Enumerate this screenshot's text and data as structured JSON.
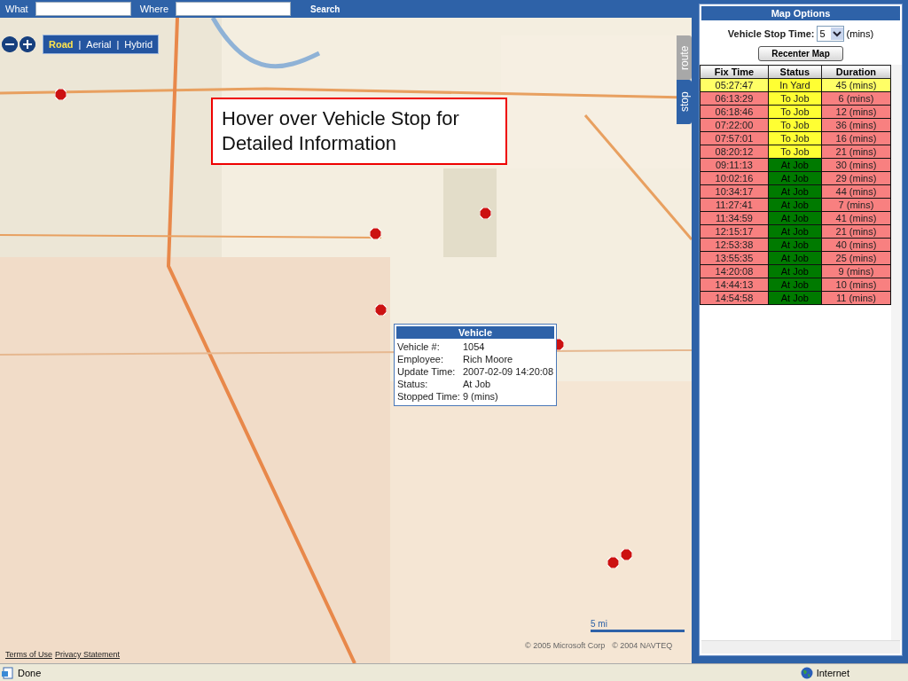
{
  "search_bar": {
    "what_label": "What",
    "where_label": "Where",
    "search_button": "Search"
  },
  "map": {
    "style_switch": [
      {
        "label": "Road",
        "selected": true
      },
      {
        "label": "Aerial",
        "selected": false
      },
      {
        "label": "Hybrid",
        "selected": false
      }
    ],
    "style_separator": "|",
    "callout": "Hover over Vehicle Stop for Detailed Information",
    "popup": {
      "title": "Vehicle",
      "fields": [
        {
          "label": "Vehicle #:",
          "value": "1054"
        },
        {
          "label": "Employee:",
          "value": "Rich Moore"
        },
        {
          "label": "Update Time:",
          "value": "2007-02-09 14:20:08"
        },
        {
          "label": "Status:",
          "value": "At Job"
        },
        {
          "label": "Stopped Time:",
          "value": "9 (mins)"
        }
      ]
    },
    "scale": "5 mi",
    "copyright": [
      "© 2005 Microsoft Corp",
      "© 2004 NAVTEQ"
    ],
    "links": [
      "Terms of Use",
      "Privacy Statement"
    ],
    "side_tabs": [
      {
        "label": "route",
        "selected": false
      },
      {
        "label": "stop",
        "selected": true
      }
    ]
  },
  "panel": {
    "title": "Map Options",
    "stop_time_label": "Vehicle Stop Time:",
    "stop_time_value": "5",
    "stop_time_unit": "(mins)",
    "recenter_button": "Recenter Map",
    "columns": [
      "Fix Time",
      "Status",
      "Duration"
    ],
    "rows": [
      {
        "fix_time": "05:27:47",
        "status": "In Yard",
        "kind": "in_yard",
        "duration": "45 (mins)"
      },
      {
        "fix_time": "06:13:29",
        "status": "To Job",
        "kind": "to_job",
        "duration": "6 (mins)"
      },
      {
        "fix_time": "06:18:46",
        "status": "To Job",
        "kind": "to_job",
        "duration": "12 (mins)"
      },
      {
        "fix_time": "07:22:00",
        "status": "To Job",
        "kind": "to_job",
        "duration": "36 (mins)"
      },
      {
        "fix_time": "07:57:01",
        "status": "To Job",
        "kind": "to_job",
        "duration": "16 (mins)"
      },
      {
        "fix_time": "08:20:12",
        "status": "To Job",
        "kind": "to_job",
        "duration": "21 (mins)"
      },
      {
        "fix_time": "09:11:13",
        "status": "At Job",
        "kind": "at_job",
        "duration": "30 (mins)"
      },
      {
        "fix_time": "10:02:16",
        "status": "At Job",
        "kind": "at_job",
        "duration": "29 (mins)"
      },
      {
        "fix_time": "10:34:17",
        "status": "At Job",
        "kind": "at_job",
        "duration": "44 (mins)"
      },
      {
        "fix_time": "11:27:41",
        "status": "At Job",
        "kind": "at_job",
        "duration": "7 (mins)"
      },
      {
        "fix_time": "11:34:59",
        "status": "At Job",
        "kind": "at_job",
        "duration": "41 (mins)"
      },
      {
        "fix_time": "12:15:17",
        "status": "At Job",
        "kind": "at_job",
        "duration": "21 (mins)"
      },
      {
        "fix_time": "12:53:38",
        "status": "At Job",
        "kind": "at_job",
        "duration": "40 (mins)"
      },
      {
        "fix_time": "13:55:35",
        "status": "At Job",
        "kind": "at_job",
        "duration": "25 (mins)"
      },
      {
        "fix_time": "14:20:08",
        "status": "At Job",
        "kind": "at_job",
        "duration": "9 (mins)"
      },
      {
        "fix_time": "14:44:13",
        "status": "At Job",
        "kind": "at_job",
        "duration": "10 (mins)"
      },
      {
        "fix_time": "14:54:58",
        "status": "At Job",
        "kind": "at_job",
        "duration": "11 (mins)"
      }
    ]
  },
  "status_bar": {
    "text": "Done",
    "zone": "Internet"
  }
}
